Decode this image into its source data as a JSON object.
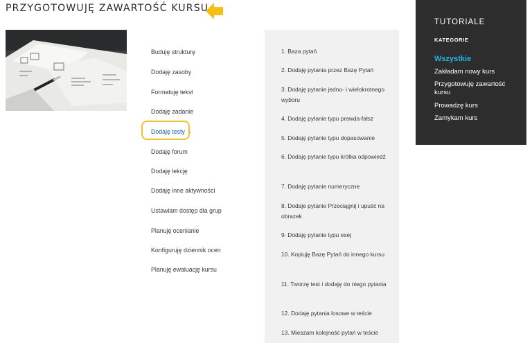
{
  "page": {
    "title": "PRZYGOTOWUJĘ ZAWARTOŚĆ KURSU",
    "accent_color": "#f2c12e",
    "link_color": "#1a5a9e"
  },
  "middle_menu": {
    "items": [
      "Buduję strukturę",
      "Dodaję zasoby",
      "Formatuję tekst",
      "Dodaję zadanie",
      "Dodaję testy",
      "Dodaję forum",
      "Dodaję lekcję",
      "Dodaję inne aktywności",
      "Ustawiam dostęp dla grup",
      "Planuję ocenianie",
      "Konfiguruję dziennik ocen",
      "Planuję ewaluację kursu"
    ],
    "active_index": 4,
    "active_marker": "▸"
  },
  "right_menu": {
    "items": [
      "1. Baza pytań",
      "2. Dodaję pytania przez Bazę Pytań",
      "3. Dodaję pytanie jedno- i wielokrotnego wyboru",
      "4. Dodaję pytanie typu prawda-fałsz",
      "5. Dodaję pytanie typu dopasowanie",
      "6. Dodaję pytanie typu krótka odpowiedź",
      "7. Dodaję pytanie numeryczne",
      "8. Dodaje pytanie Przeciągnij i upuść na obrazek",
      "9. Dodaję pytanie typu esej",
      "10. Kopiuję Bazę Pytań do innego kursu",
      "11. Tworzę test i dodaję do niego pytania",
      "12. Dodaję pytania losowe w teście",
      "13. Mieszam kolejność pytań w teście"
    ]
  },
  "sidebar": {
    "title": "TUTORIALE",
    "category_label": "KATEGORIE",
    "links": [
      "Wszystkie",
      "Zakładam nowy kurs",
      "Przygotowuję zawartość kursu",
      "Prowadzę kurs",
      "Zamykam kurs"
    ],
    "active_index": 0,
    "background": "#2d2d2d",
    "active_color": "#21b4e0"
  }
}
